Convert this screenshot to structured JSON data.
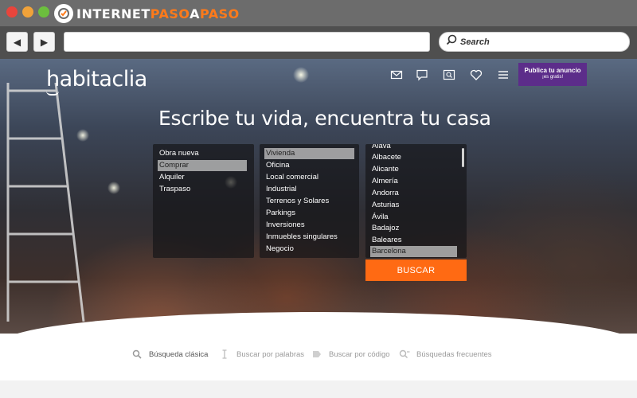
{
  "browser": {
    "brand_prefix": "INTERNET",
    "brand_accent_1": "PASO",
    "brand_middle": "A",
    "brand_accent_2": "PASO",
    "back_icon": "back-arrow-icon",
    "forward_icon": "forward-arrow-icon",
    "url": "",
    "search_placeholder": "Search"
  },
  "site": {
    "logo": "habitaclia",
    "nav_icons": [
      "mail-icon",
      "chat-icon",
      "folder-search-icon",
      "heart-icon",
      "menu-icon"
    ],
    "publish_button": {
      "line1": "Publica tu anuncio",
      "line2": "¡es gratis!"
    },
    "headline": "Escribe tu vida, encuentra tu casa",
    "operation_list": {
      "options": [
        "Obra nueva",
        "Comprar",
        "Alquiler",
        "Traspaso"
      ],
      "selected": "Comprar"
    },
    "property_type_list": {
      "options": [
        "Vivienda",
        "Oficina",
        "Local comercial",
        "Industrial",
        "Terrenos y Solares",
        "Parkings",
        "Inversiones",
        "Inmuebles singulares",
        "Negocio"
      ],
      "selected": "Vivienda"
    },
    "province_list": {
      "options": [
        "Álava",
        "Albacete",
        "Alicante",
        "Almería",
        "Andorra",
        "Asturias",
        "Ávila",
        "Badajoz",
        "Baleares",
        "Barcelona"
      ],
      "selected": "Barcelona"
    },
    "search_button": "BUSCAR",
    "search_tabs": [
      {
        "label": "Búsqueda clásica",
        "icon": "magnifier-icon"
      },
      {
        "label": "Buscar por palabras",
        "icon": "text-cursor-icon"
      },
      {
        "label": "Buscar por código",
        "icon": "tag-icon"
      },
      {
        "label": "Búsquedas frecuentes",
        "icon": "history-search-icon"
      }
    ]
  },
  "colors": {
    "accent_orange": "#ff6a13",
    "publish_purple": "#5c2d8a",
    "brand_orange": "#ff7a1a"
  }
}
